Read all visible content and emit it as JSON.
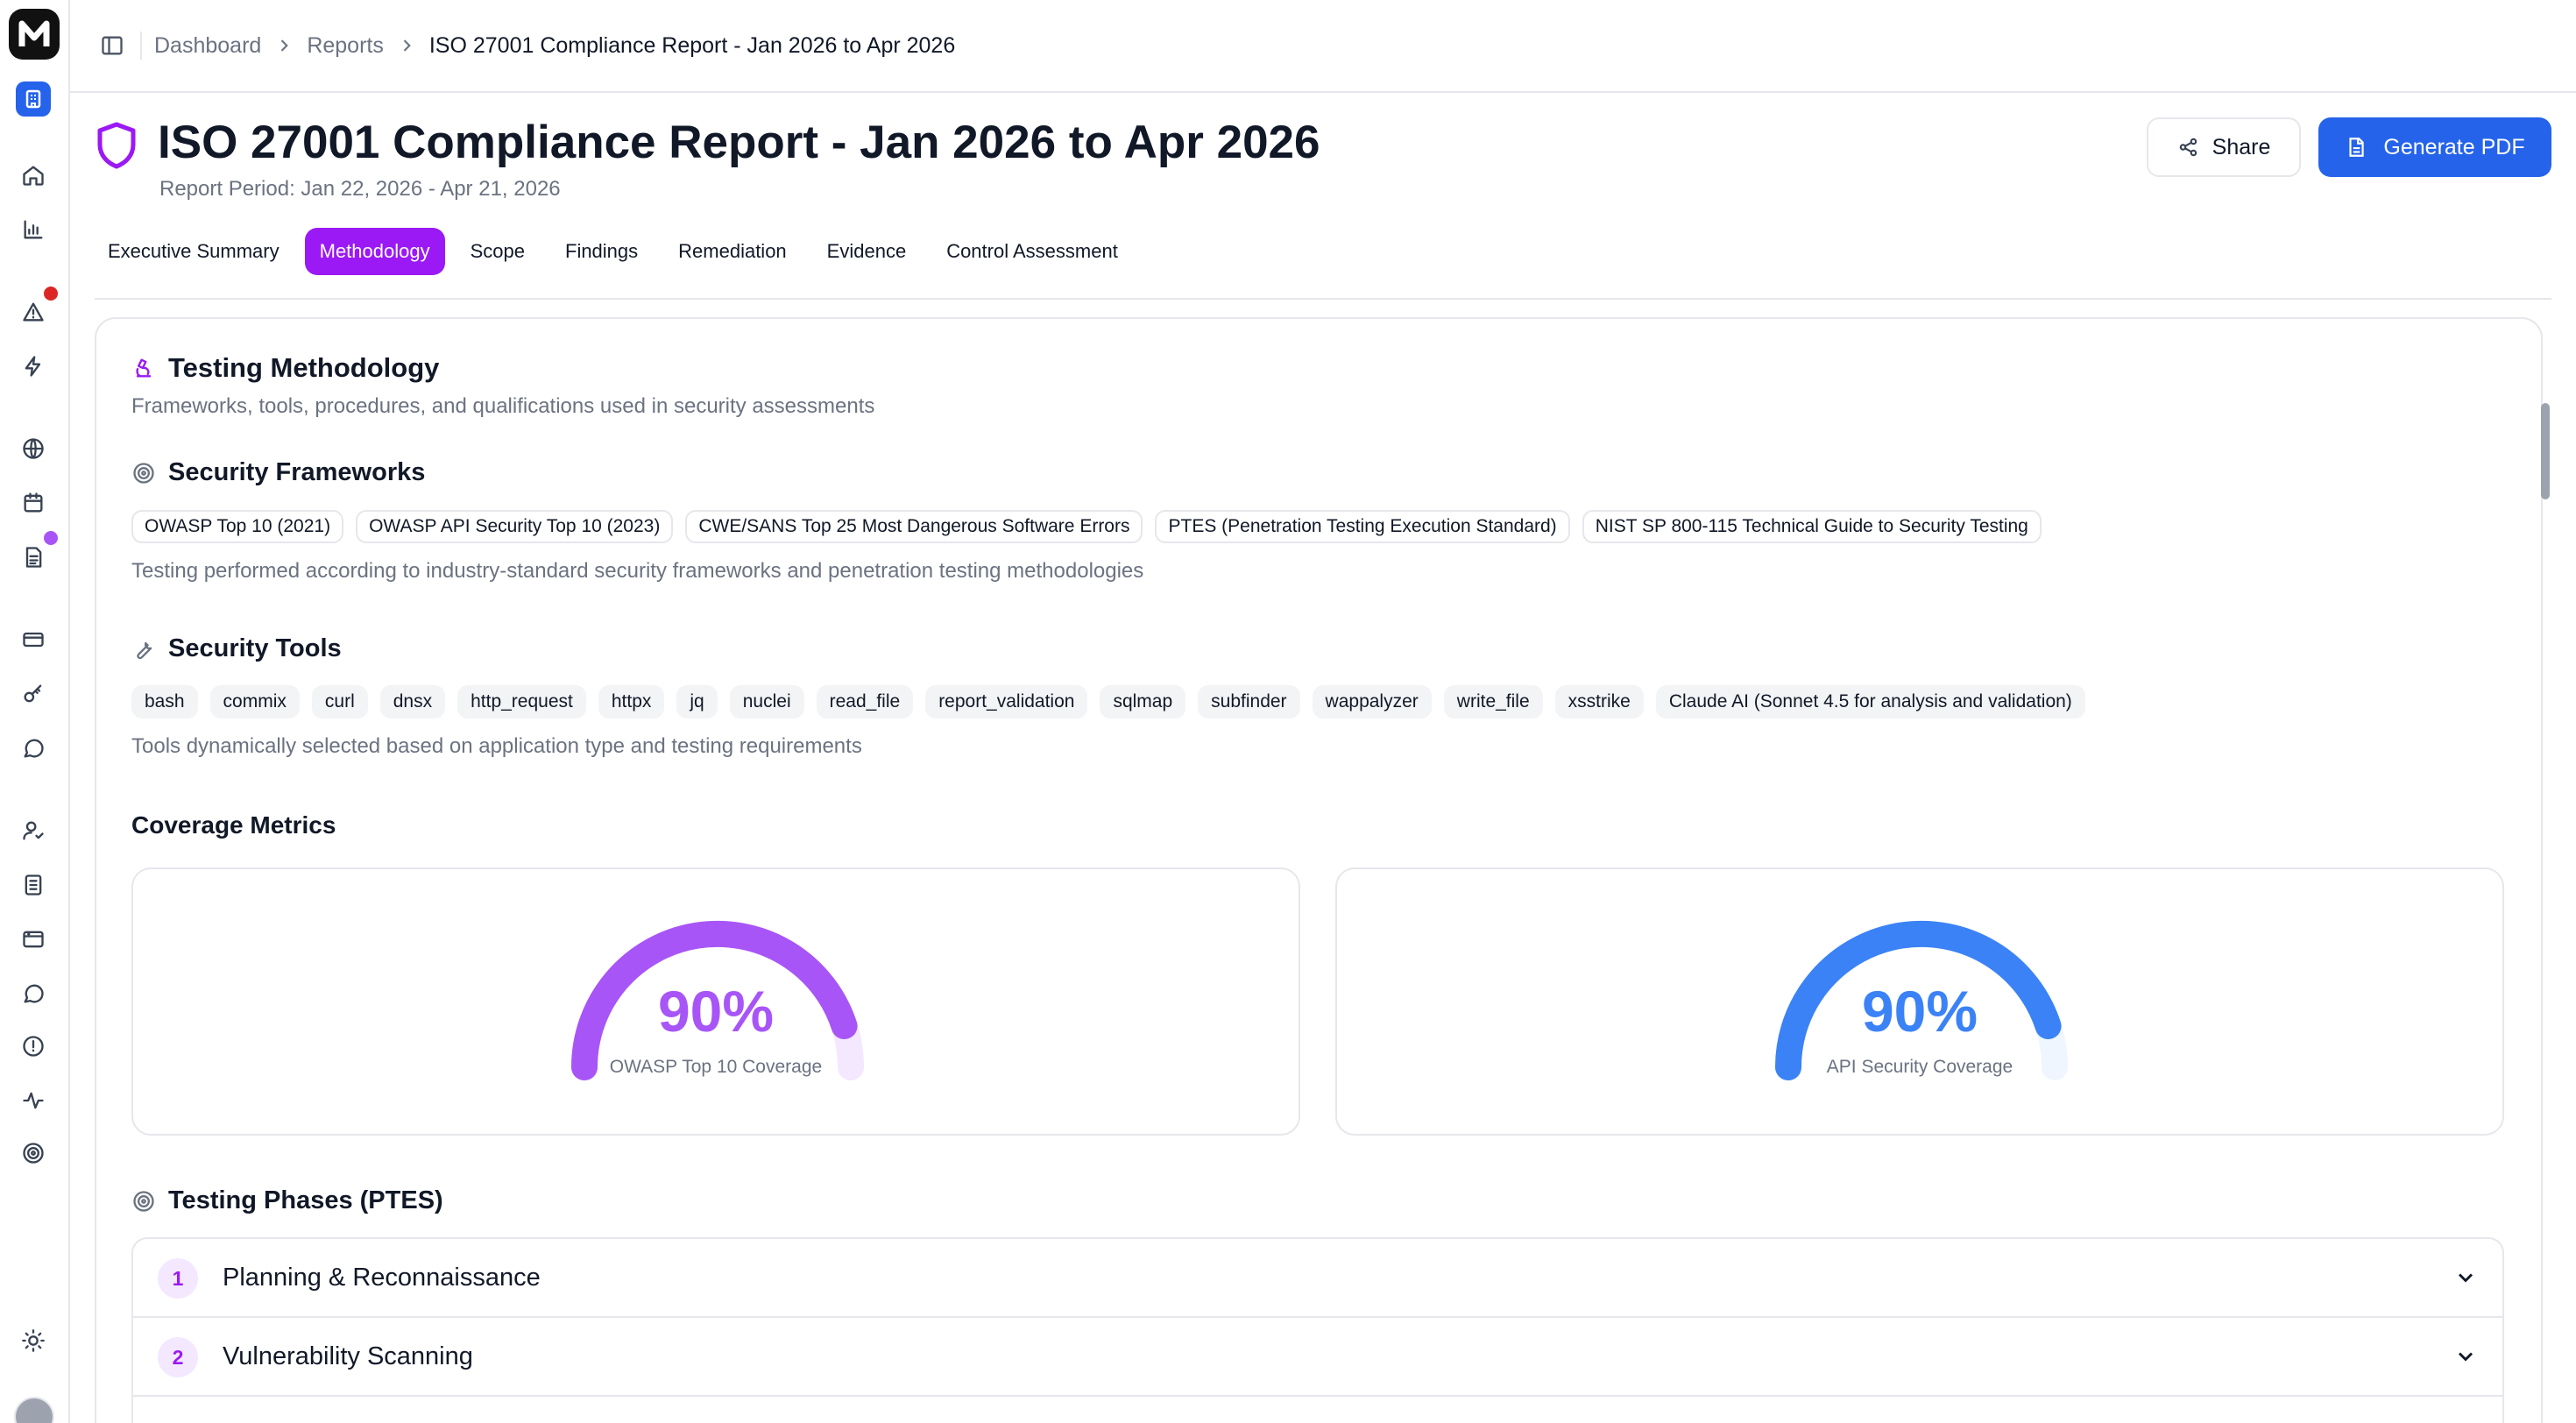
{
  "breadcrumb": {
    "items": [
      "Dashboard",
      "Reports",
      "ISO 27001 Compliance Report - Jan 2026 to Apr 2026"
    ]
  },
  "header": {
    "title": "ISO 27001 Compliance Report - Jan 2026 to Apr 2026",
    "period": "Report Period: Jan 22, 2026 - Apr 21, 2026",
    "share_label": "Share",
    "pdf_label": "Generate PDF"
  },
  "tabs": [
    {
      "label": "Executive Summary",
      "active": false
    },
    {
      "label": "Methodology",
      "active": true
    },
    {
      "label": "Scope",
      "active": false
    },
    {
      "label": "Findings",
      "active": false
    },
    {
      "label": "Remediation",
      "active": false
    },
    {
      "label": "Evidence",
      "active": false
    },
    {
      "label": "Control Assessment",
      "active": false
    }
  ],
  "methodology": {
    "title": "Testing Methodology",
    "subtitle": "Frameworks, tools, procedures, and qualifications used in security assessments"
  },
  "frameworks": {
    "title": "Security Frameworks",
    "items": [
      "OWASP Top 10 (2021)",
      "OWASP API Security Top 10 (2023)",
      "CWE/SANS Top 25 Most Dangerous Software Errors",
      "PTES (Penetration Testing Execution Standard)",
      "NIST SP 800-115 Technical Guide to Security Testing"
    ],
    "note": "Testing performed according to industry-standard security frameworks and penetration testing methodologies"
  },
  "tools": {
    "title": "Security Tools",
    "items": [
      "bash",
      "commix",
      "curl",
      "dnsx",
      "http_request",
      "httpx",
      "jq",
      "nuclei",
      "read_file",
      "report_validation",
      "sqlmap",
      "subfinder",
      "wappalyzer",
      "write_file",
      "xsstrike",
      "Claude AI (Sonnet 4.5 for analysis and validation)"
    ],
    "note": "Tools dynamically selected based on application type and testing requirements"
  },
  "coverage": {
    "title": "Coverage Metrics",
    "metrics": [
      {
        "value": "90%",
        "fraction": 0.9,
        "label": "OWASP Top 10 Coverage",
        "color": "#a855f7"
      },
      {
        "value": "90%",
        "fraction": 0.9,
        "label": "API Security Coverage",
        "color": "#3b82f6"
      }
    ]
  },
  "phases": {
    "title": "Testing Phases (PTES)",
    "items": [
      {
        "num": "1",
        "name": "Planning & Reconnaissance"
      },
      {
        "num": "2",
        "name": "Vulnerability Scanning"
      }
    ]
  },
  "colors": {
    "accent": "#9b19f5",
    "primary": "#2563eb",
    "alert_dot": "#dc2626"
  }
}
